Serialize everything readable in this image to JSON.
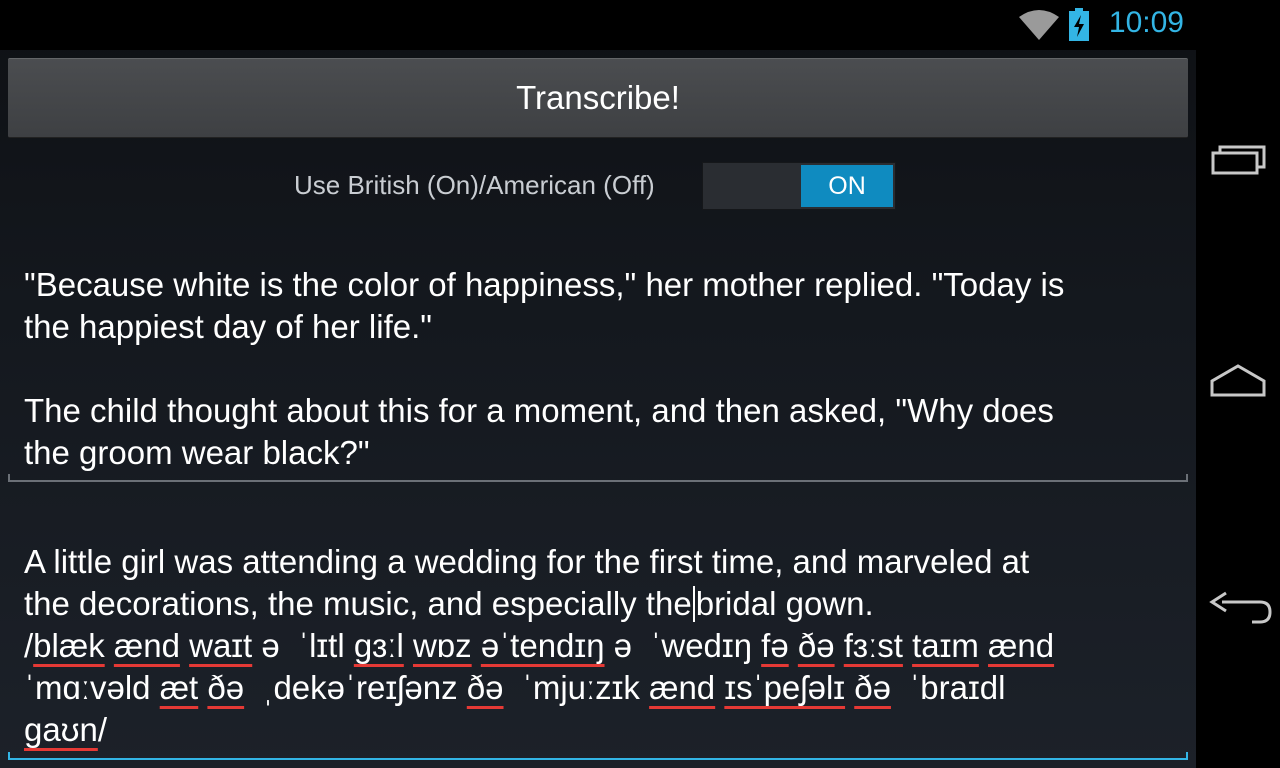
{
  "status": {
    "time": "10:09"
  },
  "colors": {
    "accent": "#33b5e5",
    "switch_on": "#0f8bc0",
    "spell_underline": "#e53935"
  },
  "icons": {
    "wifi": "wifi-icon",
    "battery": "battery-charging-icon",
    "recents": "recent-apps-icon",
    "home": "home-icon",
    "back": "back-icon"
  },
  "toolbar": {
    "transcribe_label": "Transcribe!"
  },
  "toggle": {
    "label": "Use British (On)/American (Off)",
    "state_label": "ON",
    "checked": true
  },
  "output_field": {
    "lines": [
      "\"Because white is the color of happiness,\" her mother replied. \"Today is",
      "the happiest day of her life.\"",
      "",
      "The child thought about this for a moment, and then asked, \"Why does",
      "the groom wear black?\""
    ]
  },
  "input_field": {
    "line1": "A little girl was attending a wedding for the first time, and marveled at",
    "line2_before_cursor": "the decorations, the music, and especially the",
    "line2_after_cursor": "bridal gown.",
    "ipa_line1": [
      "/",
      "blæk",
      " ",
      "ænd",
      " ",
      "waɪt",
      " ə  ˈlɪtl ",
      "gɜːl",
      " ",
      "wɒz",
      " ",
      "əˈtendɪŋ",
      " ə  ˈwedɪŋ ",
      "fə",
      " ",
      "ðə",
      " ",
      "fɜːst",
      " ",
      "taɪm",
      " ",
      "ænd"
    ],
    "ipa_line2": [
      "ˈmɑːvəld",
      " ",
      "æt",
      " ",
      "ðə",
      "  ˌdekəˈreɪʃənz ",
      "ðə",
      "  ˈmjuːzɪk ",
      "ænd",
      " ",
      "ɪsˈpeʃəlɪ",
      " ",
      "ðə",
      "  ˈbraɪdl"
    ],
    "ipa_line3": [
      "gaʊn",
      "/"
    ]
  }
}
